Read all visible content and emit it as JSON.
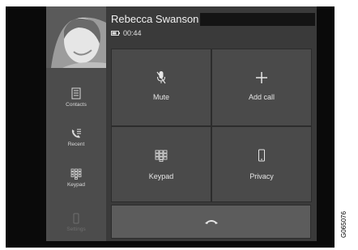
{
  "caller": {
    "name": "Rebecca Swanson",
    "duration": "00:44"
  },
  "sidebar": {
    "items": [
      {
        "label": "Contacts",
        "icon": "contacts-icon"
      },
      {
        "label": "Recent",
        "icon": "recent-calls-icon"
      },
      {
        "label": "Keypad",
        "icon": "keypad-icon"
      },
      {
        "label": "Settings",
        "icon": "phone-settings-icon"
      }
    ]
  },
  "actions": {
    "mute_label": "Mute",
    "add_call_label": "Add call",
    "keypad_label": "Keypad",
    "privacy_label": "Privacy"
  },
  "figure_code": "G065076"
}
